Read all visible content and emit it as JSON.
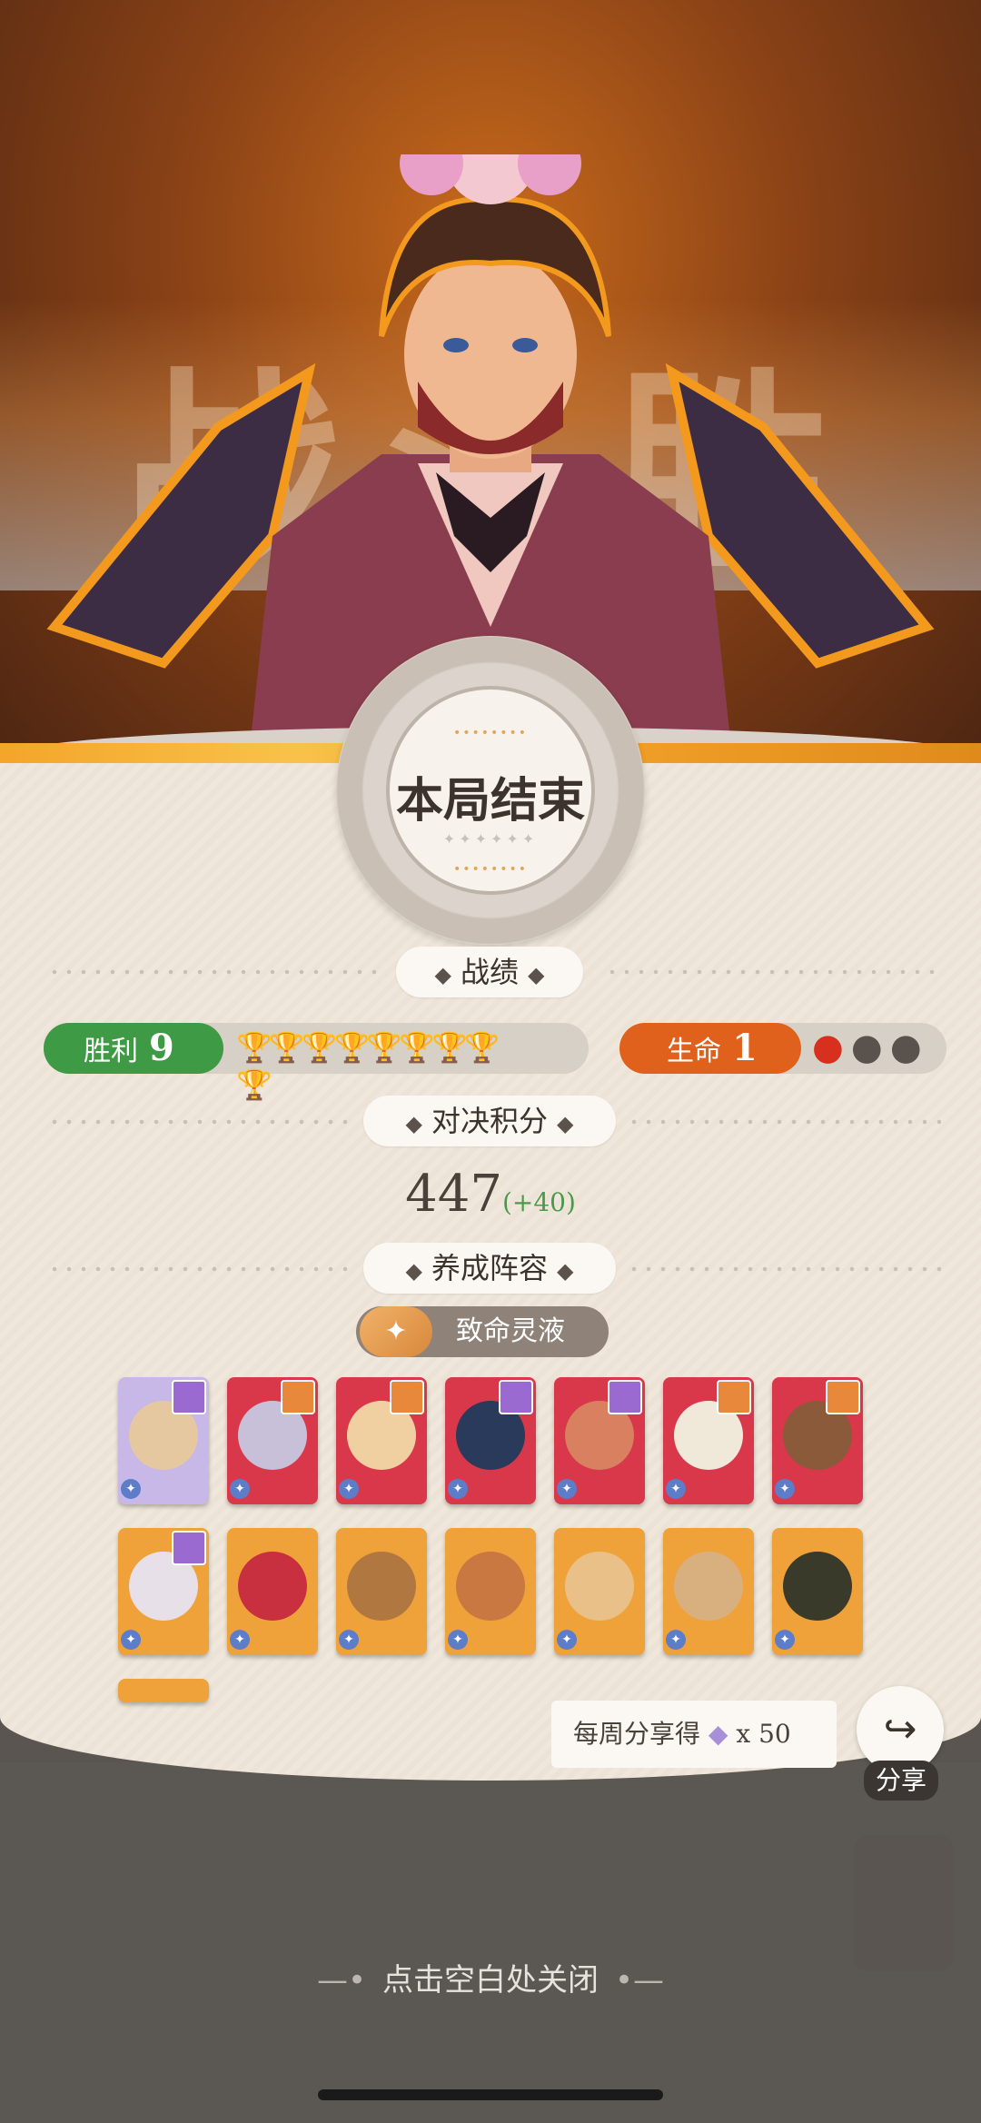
{
  "result": {
    "title": "本局结束"
  },
  "record": {
    "section_label": "战绩",
    "win_label": "胜利",
    "win_count": "9",
    "trophy_count": 9,
    "life_label": "生命",
    "life_count": "1",
    "apples": [
      "full",
      "eaten",
      "eaten"
    ]
  },
  "score": {
    "section_label": "对决积分",
    "value": "447",
    "delta": "(+40)"
  },
  "lineup": {
    "section_label": "养成阵容",
    "item_name": "致命灵液",
    "heroes": [
      {
        "name": "hero-1",
        "frame": "purple",
        "badge": "purple"
      },
      {
        "name": "hero-2",
        "frame": "red",
        "badge": "orange"
      },
      {
        "name": "hero-3",
        "frame": "red",
        "badge": "orange"
      },
      {
        "name": "hero-4",
        "frame": "red",
        "badge": "purple"
      },
      {
        "name": "hero-5",
        "frame": "red",
        "badge": "purple"
      },
      {
        "name": "hero-6",
        "frame": "red",
        "badge": "orange"
      },
      {
        "name": "hero-7",
        "frame": "red",
        "badge": "orange"
      },
      {
        "name": "hero-8",
        "frame": "orange",
        "badge": "purple"
      },
      {
        "name": "hero-9",
        "frame": "orange",
        "badge": "none"
      },
      {
        "name": "hero-10",
        "frame": "orange",
        "badge": "none"
      },
      {
        "name": "hero-11",
        "frame": "orange",
        "badge": "none"
      },
      {
        "name": "hero-12",
        "frame": "orange",
        "badge": "none"
      },
      {
        "name": "hero-13",
        "frame": "orange",
        "badge": "none"
      },
      {
        "name": "hero-14",
        "frame": "orange",
        "badge": "none"
      },
      {
        "name": "hero-15",
        "frame": "orange",
        "badge": "none"
      }
    ]
  },
  "share": {
    "note_prefix": "每周分享得",
    "gem_icon": "diamond-icon",
    "note_qty": "x 50",
    "button_label": "分享"
  },
  "footer": {
    "close_hint": "点击空白处关闭"
  },
  "colors": {
    "win": "#3e9a45",
    "life": "#e0611c",
    "accent": "#f4a52a"
  }
}
